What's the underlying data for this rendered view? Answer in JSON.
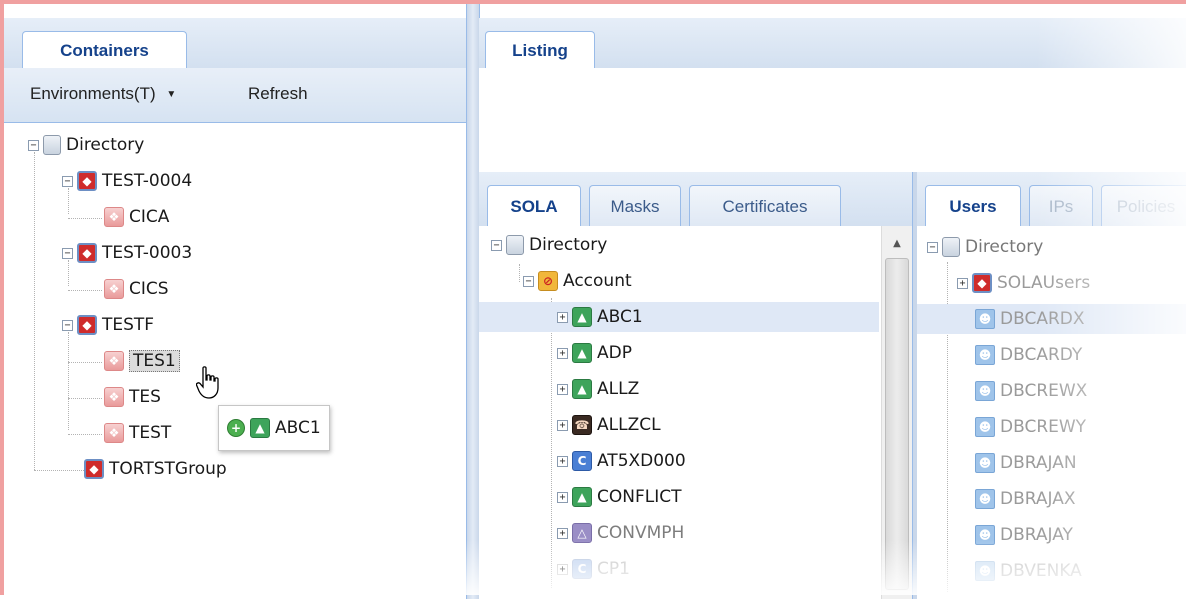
{
  "containers": {
    "tab_label": "Containers",
    "toolbar": {
      "environments_label": "Environments(T)",
      "dropdown_arrow": "▼",
      "refresh_label": "Refresh"
    },
    "tree": {
      "root": "Directory",
      "test0004": "TEST-0004",
      "cica": "CICA",
      "test0003": "TEST-0003",
      "cics": "CICS",
      "testf": "TESTF",
      "tes1": "TES1",
      "tes2": "TES",
      "test3": "TEST",
      "tortst": "TORTSTGroup"
    },
    "drag_tooltip": {
      "label": "ABC1"
    }
  },
  "listing": {
    "tab_label": "Listing"
  },
  "sola_panel": {
    "tabs": [
      "SOLA",
      "Masks",
      "Certificates"
    ],
    "tree": {
      "root": "Directory",
      "account": "Account",
      "items": [
        "ABC1",
        "ADP",
        "ALLZ",
        "ALLZCL",
        "AT5XD000",
        "CONFLICT",
        "CONVMPH",
        "CP1"
      ]
    }
  },
  "users_panel": {
    "tabs": [
      "Users",
      "IPs",
      "Policies"
    ],
    "tree": {
      "root": "Directory",
      "group": "SOLAUsers",
      "users": [
        "DBCARDX",
        "DBCARDY",
        "DBCREWX",
        "DBCREWY",
        "DBRAJAN",
        "DBRAJAX",
        "DBRAJAY",
        "DBVENKA"
      ]
    }
  },
  "colors": {
    "tab_blue": "#15428b",
    "border": "#99bbe8",
    "selection": "#dfe8f6",
    "window_border": "#f0a0a0"
  },
  "icons": {
    "expand": "plus-box",
    "collapse": "minus-box",
    "directory": "server-icon",
    "environment": "red-container-icon",
    "region": "pink-region-icon",
    "transaction": "green-arrow-icon",
    "phone": "phone-icon",
    "c": "c-letter-icon",
    "user": "user-icon",
    "folder": "folder-icon",
    "add": "green-plus-icon",
    "cursor": "hand-cursor-icon"
  }
}
